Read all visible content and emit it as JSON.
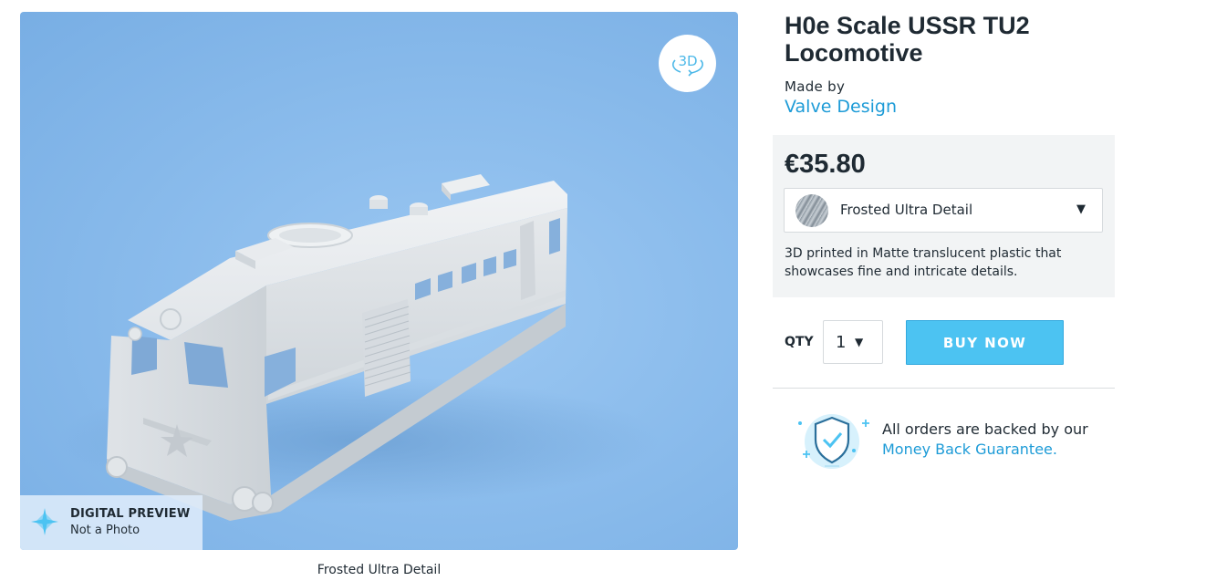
{
  "product": {
    "title": "H0e Scale USSR TU2 Locomotive",
    "made_by_label": "Made by",
    "designer": "Valve Design"
  },
  "viewer": {
    "badge_3d_label": "3D",
    "preview_title": "DIGITAL PREVIEW",
    "preview_subtitle": "Not a Photo",
    "caption": "Frosted Ultra Detail"
  },
  "purchase": {
    "price": "€35.80",
    "material": "Frosted Ultra Detail",
    "material_description": "3D printed in Matte translucent plastic that showcases fine and intricate details.",
    "qty_label": "QTY",
    "qty_value": "1",
    "buy_label": "BUY NOW"
  },
  "guarantee": {
    "text": "All orders are backed by our",
    "link": "Money Back Guarantee."
  },
  "colors": {
    "accent": "#1d9bd7",
    "button": "#4cc3f2",
    "viewer_bg": "#8bbcec"
  },
  "icons": {
    "view_3d": "rotate-3d-icon",
    "preview": "sparkle-icon",
    "material": "material-swatch",
    "caret": "chevron-down-icon",
    "guarantee": "shield-check-icon"
  }
}
